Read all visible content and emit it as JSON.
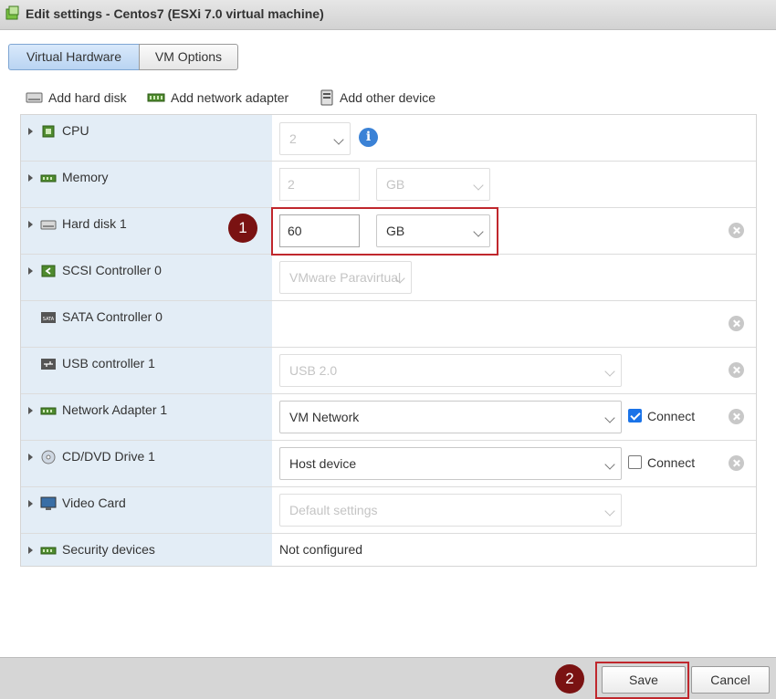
{
  "window": {
    "title": "Edit settings - Centos7 (ESXi 7.0 virtual machine)"
  },
  "tabs": [
    {
      "label": "Virtual Hardware",
      "active": true
    },
    {
      "label": "VM Options",
      "active": false
    }
  ],
  "toolbar": {
    "add_hard_disk": "Add hard disk",
    "add_network_adapter": "Add network adapter",
    "add_other_device": "Add other device"
  },
  "rows": {
    "cpu": {
      "label": "CPU",
      "value": "2"
    },
    "memory": {
      "label": "Memory",
      "value": "2",
      "unit": "GB"
    },
    "hard_disk": {
      "label": "Hard disk 1",
      "value": "60",
      "unit": "GB"
    },
    "scsi": {
      "label": "SCSI Controller 0",
      "value": "VMware Paravirtual"
    },
    "sata": {
      "label": "SATA Controller 0"
    },
    "usb": {
      "label": "USB controller 1",
      "value": "USB 2.0"
    },
    "network": {
      "label": "Network Adapter 1",
      "value": "VM Network",
      "connect_label": "Connect",
      "connected": true
    },
    "cdrom": {
      "label": "CD/DVD Drive 1",
      "value": "Host device",
      "connect_label": "Connect",
      "connected": false
    },
    "video": {
      "label": "Video Card",
      "value": "Default settings"
    },
    "security": {
      "label": "Security devices",
      "value": "Not configured"
    }
  },
  "annotations": {
    "step1": "1",
    "step2": "2"
  },
  "footer": {
    "save_label": "Save",
    "cancel_label": "Cancel"
  },
  "colors": {
    "accent_red": "#c0272d",
    "badge": "#7a1212",
    "label_column": "#e3edf6",
    "checkbox_blue": "#1a73e8"
  }
}
